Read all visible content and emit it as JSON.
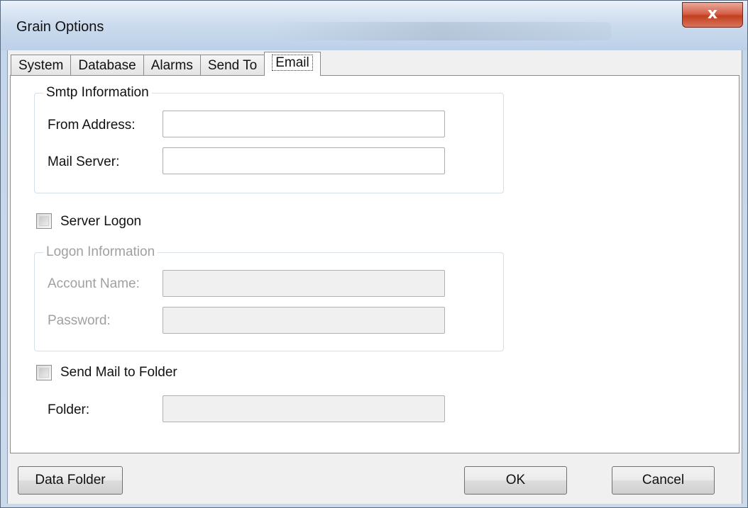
{
  "window": {
    "title": "Grain Options",
    "close_glyph": "x"
  },
  "tabs": [
    "System",
    "Database",
    "Alarms",
    "Send To",
    "Email"
  ],
  "active_tab": "Email",
  "smtp": {
    "legend": "Smtp Information",
    "from_label": "From Address:",
    "from_value": "",
    "server_label": "Mail Server:",
    "server_value": ""
  },
  "server_logon": {
    "label": "Server Logon",
    "checked": false
  },
  "logon": {
    "legend": "Logon Information",
    "account_label": "Account Name:",
    "account_value": "",
    "password_label": "Password:",
    "password_value": ""
  },
  "send_to_folder": {
    "label": "Send Mail to Folder",
    "checked": false
  },
  "folder": {
    "label": "Folder:",
    "value": ""
  },
  "buttons": {
    "data_folder": "Data Folder",
    "ok": "OK",
    "cancel": "Cancel"
  },
  "colors": {
    "disabled_text": "#a0a0a0",
    "close_button": "#c2401f",
    "title_bar": "#cddcee"
  },
  "icons": {
    "close": "close-icon"
  }
}
